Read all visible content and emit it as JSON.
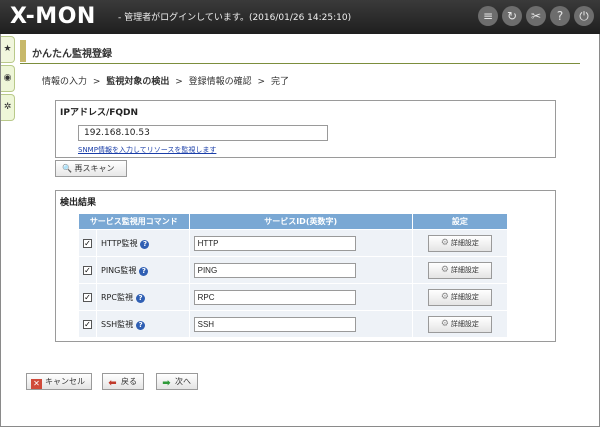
{
  "app": {
    "logo": "X-MON",
    "status": "- 管理者がログインしています。(2016/01/26 14:25:10)",
    "header_icons": [
      "database-icon",
      "refresh-icon",
      "tools-icon",
      "help-icon",
      "power-icon"
    ]
  },
  "sidetabs": [
    "★",
    "◉",
    "✲"
  ],
  "page": {
    "title": "かんたん監視登録",
    "breadcrumb": {
      "step1": "情報の入力",
      "step2": "監視対象の検出",
      "step3": "登録情報の確認",
      "step4": "完了",
      "sep": ">"
    }
  },
  "ip_section": {
    "title": "IPアドレス/FQDN",
    "value": "192.168.10.53",
    "snmp_link": "SNMP情報を入力してリソースを監視します"
  },
  "rescan_label": "再スキャン",
  "results": {
    "title": "検出結果",
    "headers": {
      "command": "サービス監視用コマンド",
      "service_id": "サービスID(英数字)",
      "settings": "設定"
    },
    "rows": [
      {
        "checked": "✓",
        "name": "HTTP監視",
        "id": "HTTP",
        "button": "詳細設定"
      },
      {
        "checked": "✓",
        "name": "PING監視",
        "id": "PING",
        "button": "詳細設定"
      },
      {
        "checked": "✓",
        "name": "RPC監視",
        "id": "RPC",
        "button": "詳細設定"
      },
      {
        "checked": "✓",
        "name": "SSH監視",
        "id": "SSH",
        "button": "詳細設定"
      }
    ]
  },
  "footer": {
    "cancel": "キャンセル",
    "back": "戻る",
    "next": "次へ"
  },
  "colors": {
    "header_bg": "#2a2a2a",
    "table_header": "#7aa8d4",
    "table_cell": "#eef2f7",
    "title_underline": "#7c8e3d"
  }
}
